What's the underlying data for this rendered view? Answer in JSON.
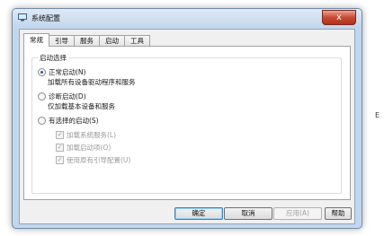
{
  "window": {
    "title": "系统配置",
    "close_glyph": "x"
  },
  "tabs": [
    {
      "label": "常规",
      "active": true
    },
    {
      "label": "引导",
      "active": false
    },
    {
      "label": "服务",
      "active": false
    },
    {
      "label": "启动",
      "active": false
    },
    {
      "label": "工具",
      "active": false
    }
  ],
  "startup_selection": {
    "legend": "启动选择",
    "options": [
      {
        "label": "正常启动(N)",
        "description": "加载所有设备驱动程序和服务",
        "selected": true
      },
      {
        "label": "诊断启动(D)",
        "description": "仅加载基本设备和服务",
        "selected": false
      },
      {
        "label": "有选择的启动(S)",
        "description": "",
        "selected": false
      }
    ],
    "selective_items": [
      {
        "label": "加载系统服务(L)",
        "checked": true,
        "enabled": false
      },
      {
        "label": "加载启动项(O)",
        "checked": true,
        "enabled": false
      },
      {
        "label": "使用原有引导配置(U)",
        "checked": true,
        "enabled": false
      }
    ]
  },
  "buttons": {
    "ok": "确定",
    "cancel": "取消",
    "apply": "应用(A)",
    "help": "帮助"
  },
  "background": {
    "side_text": "E"
  }
}
